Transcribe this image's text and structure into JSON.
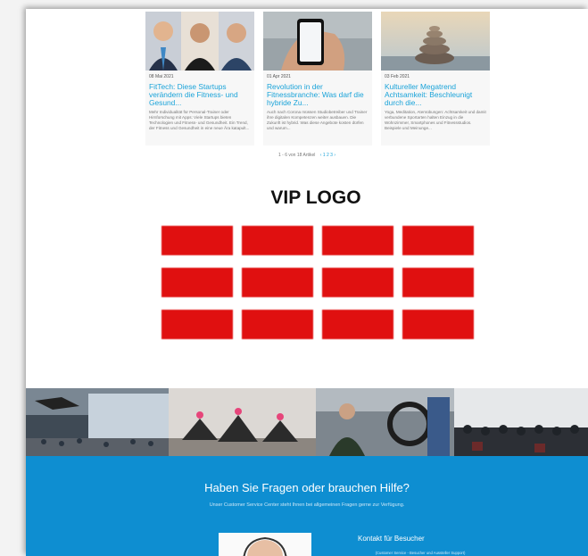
{
  "articles": [
    {
      "date": "08 Mai 2021",
      "title": "FitTech: Diese Startups verändern die Fitness- und Gesund...",
      "excerpt": "Mehr Individualität für Personal-Trainer oder Hirnforschung mit Apps: Viele Startups bieten Technologien und Fitness- und Gesundheit. Ein Trend, der Fitness und Gesundheit in eine neue Ära katapult..."
    },
    {
      "date": "01 Apr 2021",
      "title": "Revolution in der Fitnessbranche: Was darf die hybride Zu...",
      "excerpt": "Auch nach Corona müssen Studiobetreiber und Trainer ihre digitalen Kompetenzen weiter ausbauen. Die Zukunft ist hybrid. Was diese Angebote kosten dürfen und warum..."
    },
    {
      "date": "03 Feb 2021",
      "title": "Kultureller Megatrend Achtsamkeit: Beschleunigt durch die...",
      "excerpt": "Yoga, Meditation, Atemübungen: Achtsamkeit und damit verbundene Sportarten halten Einzug in die Wohnzimmer, Smartphones und Fitnessstudios. Beispiele und Meinunge..."
    }
  ],
  "pagination": {
    "summary": "1 - 6 von 18 Artikel",
    "links": "‹ 1 2 3 ›"
  },
  "vip": {
    "title": "VIP LOGO",
    "box_color": "#e01010",
    "rows": 3,
    "cols": 4
  },
  "help": {
    "heading": "Haben Sie Fragen oder brauchen Hilfe?",
    "subtext": "Unser Customer Service Center steht Ihnen bei allgemeinen Fragen gerne zur Verfügung.",
    "contact_title": "Kontakt für Besucher",
    "contact_sub": "(Customer Service - Besucher und Aussteller Support)",
    "bg_color": "#0e8ed1"
  }
}
